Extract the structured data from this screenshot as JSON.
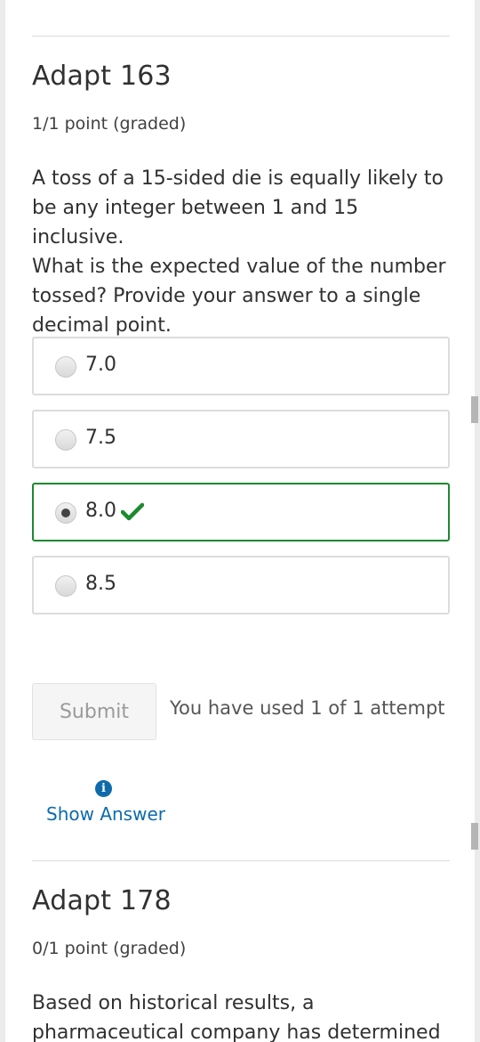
{
  "problem1": {
    "title": "Adapt 163",
    "points": "1/1 point (graded)",
    "question_lines": [
      "A toss of a 15-sided die is equally likely to",
      "be any integer between 1 and 15 inclusive.",
      "What is the expected value of the number",
      "tossed? Provide your answer to a single",
      "decimal point."
    ],
    "choices": [
      {
        "label": "7.0",
        "selected": false,
        "correct": false
      },
      {
        "label": "7.5",
        "selected": false,
        "correct": false
      },
      {
        "label": "8.0",
        "selected": true,
        "correct": true
      },
      {
        "label": "8.5",
        "selected": false,
        "correct": false
      }
    ],
    "submit_label": "Submit",
    "attempts_text": "You have used 1 of 1 attempt",
    "show_answer_label": "Show Answer"
  },
  "problem2": {
    "title": "Adapt 178",
    "points": "0/1 point (graded)",
    "question_lines": [
      "Based on historical results, a",
      "pharmaceutical company has determined"
    ]
  },
  "colors": {
    "correct_border": "#1c8a2e",
    "link": "#0d6bab",
    "choice_border": "#dcdcdc"
  },
  "icons": {
    "check": "check-icon",
    "info": "info-icon"
  }
}
